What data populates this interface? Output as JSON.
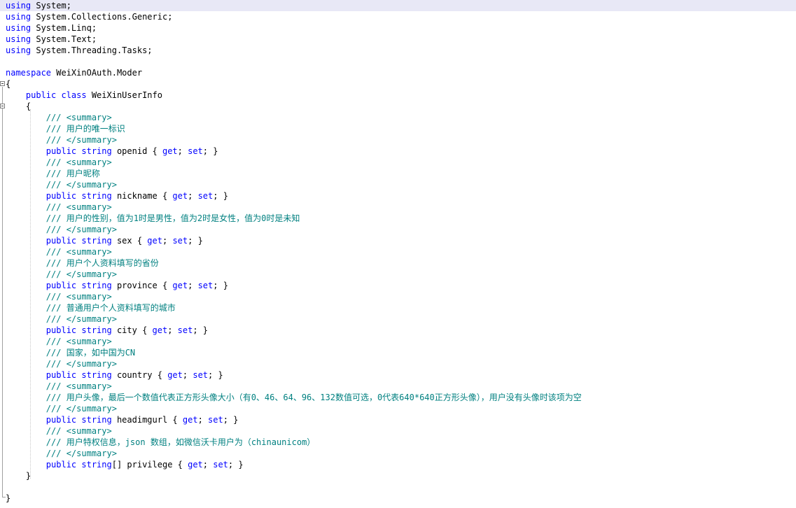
{
  "editor": {
    "lines": [
      [
        {
          "c": "kw",
          "t": "using"
        },
        {
          "c": "tx",
          "t": " System;"
        }
      ],
      [
        {
          "c": "kw",
          "t": "using"
        },
        {
          "c": "tx",
          "t": " System.Collections.Generic;"
        }
      ],
      [
        {
          "c": "kw",
          "t": "using"
        },
        {
          "c": "tx",
          "t": " System.Linq;"
        }
      ],
      [
        {
          "c": "kw",
          "t": "using"
        },
        {
          "c": "tx",
          "t": " System.Text;"
        }
      ],
      [
        {
          "c": "kw",
          "t": "using"
        },
        {
          "c": "tx",
          "t": " System.Threading.Tasks;"
        }
      ],
      [],
      [
        {
          "c": "kw",
          "t": "namespace"
        },
        {
          "c": "tx",
          "t": " WeiXinOAuth.Moder"
        }
      ],
      [
        {
          "c": "tx",
          "t": "{"
        }
      ],
      [
        {
          "c": "tx",
          "t": "    "
        },
        {
          "c": "kw",
          "t": "public class"
        },
        {
          "c": "tx",
          "t": " WeiXinUserInfo"
        }
      ],
      [
        {
          "c": "tx",
          "t": "    {"
        }
      ],
      [
        {
          "c": "tx",
          "t": "        "
        },
        {
          "c": "cm",
          "t": "/// <summary>"
        }
      ],
      [
        {
          "c": "tx",
          "t": "        "
        },
        {
          "c": "cm",
          "t": "/// 用户的唯一标识"
        }
      ],
      [
        {
          "c": "tx",
          "t": "        "
        },
        {
          "c": "cm",
          "t": "/// </summary>"
        }
      ],
      [
        {
          "c": "tx",
          "t": "        "
        },
        {
          "c": "kw",
          "t": "public string"
        },
        {
          "c": "tx",
          "t": " openid { "
        },
        {
          "c": "kw",
          "t": "get"
        },
        {
          "c": "tx",
          "t": "; "
        },
        {
          "c": "kw",
          "t": "set"
        },
        {
          "c": "tx",
          "t": "; }"
        }
      ],
      [
        {
          "c": "tx",
          "t": "        "
        },
        {
          "c": "cm",
          "t": "/// <summary>"
        }
      ],
      [
        {
          "c": "tx",
          "t": "        "
        },
        {
          "c": "cm",
          "t": "/// 用户昵称"
        }
      ],
      [
        {
          "c": "tx",
          "t": "        "
        },
        {
          "c": "cm",
          "t": "/// </summary>"
        }
      ],
      [
        {
          "c": "tx",
          "t": "        "
        },
        {
          "c": "kw",
          "t": "public string"
        },
        {
          "c": "tx",
          "t": " nickname { "
        },
        {
          "c": "kw",
          "t": "get"
        },
        {
          "c": "tx",
          "t": "; "
        },
        {
          "c": "kw",
          "t": "set"
        },
        {
          "c": "tx",
          "t": "; }"
        }
      ],
      [
        {
          "c": "tx",
          "t": "        "
        },
        {
          "c": "cm",
          "t": "/// <summary>"
        }
      ],
      [
        {
          "c": "tx",
          "t": "        "
        },
        {
          "c": "cm",
          "t": "/// 用户的性别，值为1时是男性，值为2时是女性，值为0时是未知"
        }
      ],
      [
        {
          "c": "tx",
          "t": "        "
        },
        {
          "c": "cm",
          "t": "/// </summary>"
        }
      ],
      [
        {
          "c": "tx",
          "t": "        "
        },
        {
          "c": "kw",
          "t": "public string"
        },
        {
          "c": "tx",
          "t": " sex { "
        },
        {
          "c": "kw",
          "t": "get"
        },
        {
          "c": "tx",
          "t": "; "
        },
        {
          "c": "kw",
          "t": "set"
        },
        {
          "c": "tx",
          "t": "; }"
        }
      ],
      [
        {
          "c": "tx",
          "t": "        "
        },
        {
          "c": "cm",
          "t": "/// <summary>"
        }
      ],
      [
        {
          "c": "tx",
          "t": "        "
        },
        {
          "c": "cm",
          "t": "/// 用户个人资料填写的省份"
        }
      ],
      [
        {
          "c": "tx",
          "t": "        "
        },
        {
          "c": "cm",
          "t": "/// </summary>"
        }
      ],
      [
        {
          "c": "tx",
          "t": "        "
        },
        {
          "c": "kw",
          "t": "public string"
        },
        {
          "c": "tx",
          "t": " province { "
        },
        {
          "c": "kw",
          "t": "get"
        },
        {
          "c": "tx",
          "t": "; "
        },
        {
          "c": "kw",
          "t": "set"
        },
        {
          "c": "tx",
          "t": "; }"
        }
      ],
      [
        {
          "c": "tx",
          "t": "        "
        },
        {
          "c": "cm",
          "t": "/// <summary>"
        }
      ],
      [
        {
          "c": "tx",
          "t": "        "
        },
        {
          "c": "cm",
          "t": "/// 普通用户个人资料填写的城市"
        }
      ],
      [
        {
          "c": "tx",
          "t": "        "
        },
        {
          "c": "cm",
          "t": "/// </summary>"
        }
      ],
      [
        {
          "c": "tx",
          "t": "        "
        },
        {
          "c": "kw",
          "t": "public string"
        },
        {
          "c": "tx",
          "t": " city { "
        },
        {
          "c": "kw",
          "t": "get"
        },
        {
          "c": "tx",
          "t": "; "
        },
        {
          "c": "kw",
          "t": "set"
        },
        {
          "c": "tx",
          "t": "; }"
        }
      ],
      [
        {
          "c": "tx",
          "t": "        "
        },
        {
          "c": "cm",
          "t": "/// <summary>"
        }
      ],
      [
        {
          "c": "tx",
          "t": "        "
        },
        {
          "c": "cm",
          "t": "/// 国家，如中国为CN"
        }
      ],
      [
        {
          "c": "tx",
          "t": "        "
        },
        {
          "c": "cm",
          "t": "/// </summary>"
        }
      ],
      [
        {
          "c": "tx",
          "t": "        "
        },
        {
          "c": "kw",
          "t": "public string"
        },
        {
          "c": "tx",
          "t": " country { "
        },
        {
          "c": "kw",
          "t": "get"
        },
        {
          "c": "tx",
          "t": "; "
        },
        {
          "c": "kw",
          "t": "set"
        },
        {
          "c": "tx",
          "t": "; }"
        }
      ],
      [
        {
          "c": "tx",
          "t": "        "
        },
        {
          "c": "cm",
          "t": "/// <summary>"
        }
      ],
      [
        {
          "c": "tx",
          "t": "        "
        },
        {
          "c": "cm",
          "t": "/// 用户头像，最后一个数值代表正方形头像大小（有0、46、64、96、132数值可选，0代表640*640正方形头像），用户没有头像时该项为空"
        }
      ],
      [
        {
          "c": "tx",
          "t": "        "
        },
        {
          "c": "cm",
          "t": "/// </summary>"
        }
      ],
      [
        {
          "c": "tx",
          "t": "        "
        },
        {
          "c": "kw",
          "t": "public string"
        },
        {
          "c": "tx",
          "t": " headimgurl { "
        },
        {
          "c": "kw",
          "t": "get"
        },
        {
          "c": "tx",
          "t": "; "
        },
        {
          "c": "kw",
          "t": "set"
        },
        {
          "c": "tx",
          "t": "; }"
        }
      ],
      [
        {
          "c": "tx",
          "t": "        "
        },
        {
          "c": "cm",
          "t": "/// <summary>"
        }
      ],
      [
        {
          "c": "tx",
          "t": "        "
        },
        {
          "c": "cm",
          "t": "/// 用户特权信息，json 数组，如微信沃卡用户为（chinaunicom）"
        }
      ],
      [
        {
          "c": "tx",
          "t": "        "
        },
        {
          "c": "cm",
          "t": "/// </summary>"
        }
      ],
      [
        {
          "c": "tx",
          "t": "        "
        },
        {
          "c": "kw",
          "t": "public string"
        },
        {
          "c": "tx",
          "t": "[] privilege { "
        },
        {
          "c": "kw",
          "t": "get"
        },
        {
          "c": "tx",
          "t": "; "
        },
        {
          "c": "kw",
          "t": "set"
        },
        {
          "c": "tx",
          "t": "; }"
        }
      ],
      [
        {
          "c": "tx",
          "t": "    }"
        }
      ],
      [],
      [
        {
          "c": "tx",
          "t": "}"
        }
      ]
    ]
  },
  "colors": {
    "keyword": "#0000ff",
    "comment": "#008080",
    "text": "#000000",
    "current_line": "#e8e8f6"
  }
}
